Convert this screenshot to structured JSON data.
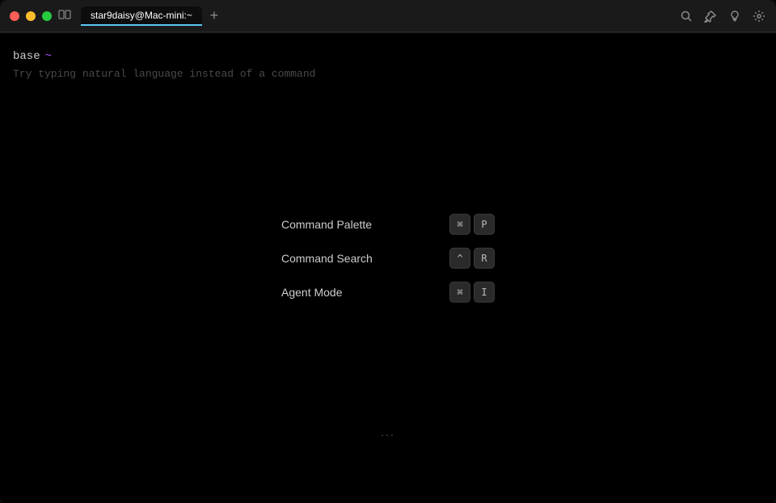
{
  "window": {
    "title": "star9daisy@Mac-mini:~"
  },
  "titleBar": {
    "trafficLights": {
      "close_label": "close",
      "minimize_label": "minimize",
      "maximize_label": "maximize"
    },
    "tabTitle": "star9daisy@Mac-mini:~",
    "newTabIcon": "+",
    "tabIcon": "⊞",
    "icons": {
      "search": "search-icon",
      "pin": "pin-icon",
      "bulb": "bulb-icon",
      "settings": "settings-icon"
    }
  },
  "commandMenu": {
    "items": [
      {
        "label": "Command Palette",
        "keys": [
          "⌘",
          "P"
        ]
      },
      {
        "label": "Command Search",
        "keys": [
          "^",
          "R"
        ]
      },
      {
        "label": "Agent Mode",
        "keys": [
          "⌘",
          "I"
        ]
      }
    ]
  },
  "ellipsis": "...",
  "bottomBar": {
    "promptBase": "base",
    "promptTilde": "~",
    "hintText": "Try typing natural language instead of a command"
  }
}
